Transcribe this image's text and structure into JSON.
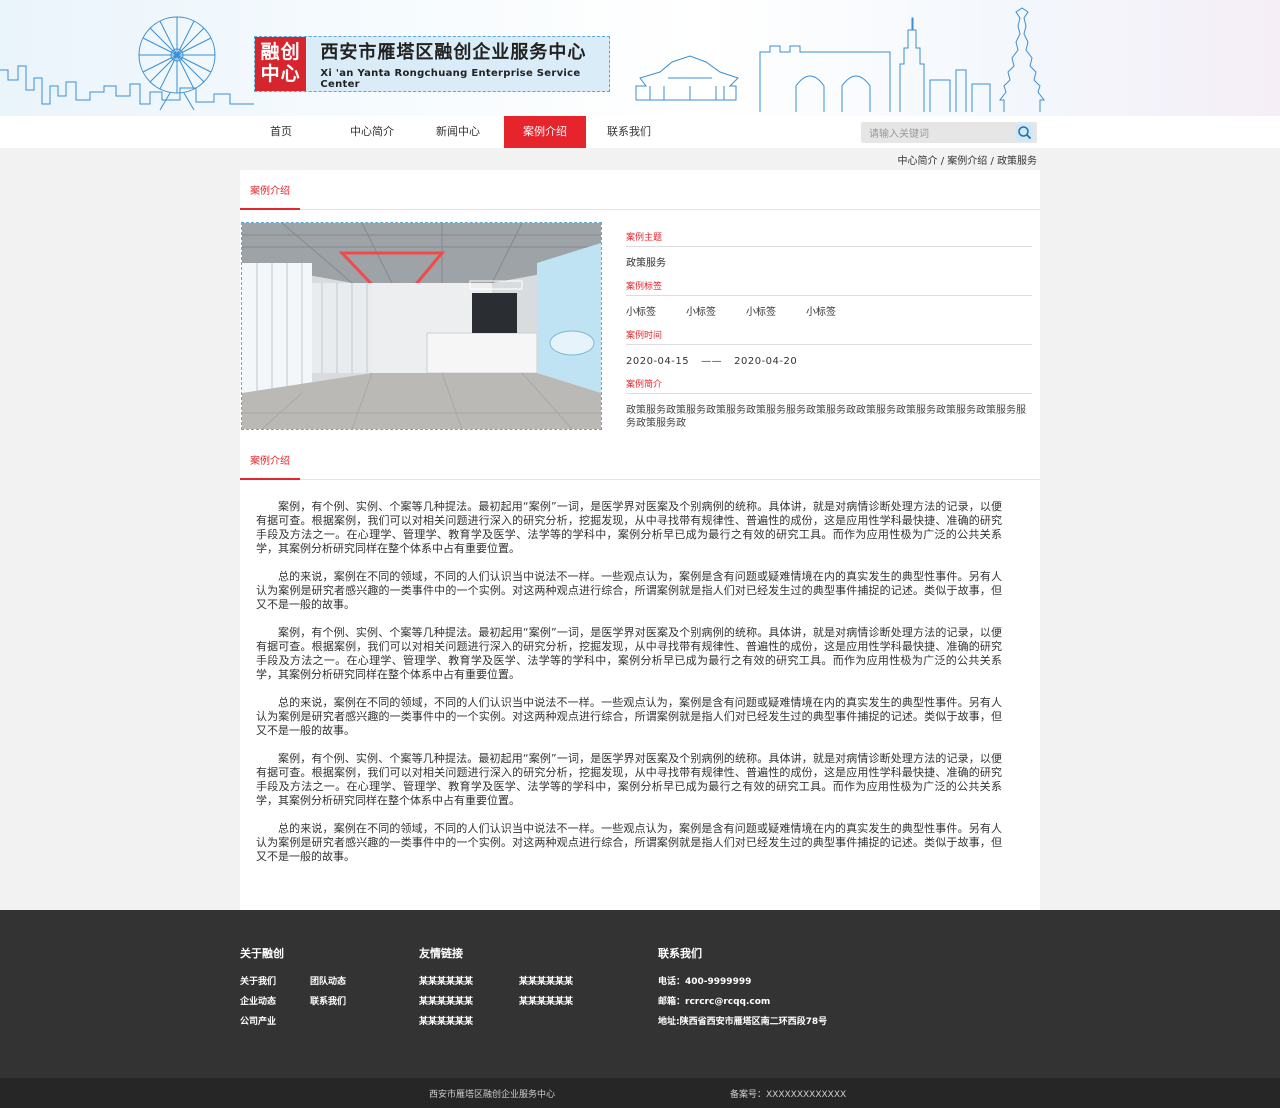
{
  "header": {
    "logo_seal": "融创中心",
    "logo_cn": "西安市雁塔区融创企业服务中心",
    "logo_en": "Xi 'an Yanta Rongchuang Enterprise Service Center"
  },
  "nav": {
    "items": [
      "首页",
      "中心简介",
      "新闻中心",
      "案例介绍",
      "联系我们"
    ],
    "active": "案例介绍"
  },
  "search": {
    "placeholder": "请输入关键词"
  },
  "breadcrumb": "中心简介 / 案例介绍 / 政策服务",
  "case_section": {
    "tab_label": "案例介绍",
    "subject_label": "案例主题",
    "subject_value": "政策服务",
    "tags_label": "案例标签",
    "tags": [
      "小标签",
      "小标签",
      "小标签",
      "小标签"
    ],
    "time_label": "案例时间",
    "start_date": "2020-04-15",
    "date_sep": "——",
    "end_date": "2020-04-20",
    "intro_label": "案例简介",
    "intro_text": "政策服务政策服务政策服务政策服务服务政策服务政政策服务政策服务政策服务政策服务服务政策服务政"
  },
  "article_section": {
    "tab_label": "案例介绍",
    "paragraphs": [
      "案例，有个例、实例、个案等几种提法。最初起用“案例”一词，是医学界对医案及个别病例的统称。具体讲，就是对病情诊断处理方法的记录，以便有据可查。根据案例，我们可以对相关问题进行深入的研究分析，挖掘发现，从中寻找带有规律性、普遍性的成份，这是应用性学科最快捷、准确的研究手段及方法之一。在心理学、管理学、教育学及医学、法学等的学科中，案例分析早已成为最行之有效的研究工具。而作为应用性极为广泛的公共关系学，其案例分析研究同样在整个体系中占有重要位置。",
      "总的来说，案例在不同的领域，不同的人们认识当中说法不一样。一些观点认为，案例是含有问题或疑难情境在内的真实发生的典型性事件。另有人认为案例是研究者感兴趣的一类事件中的一个实例。对这两种观点进行综合，所谓案例就是指人们对已经发生过的典型事件捕捉的记述。类似于故事，但又不是一般的故事。",
      "案例，有个例、实例、个案等几种提法。最初起用“案例”一词，是医学界对医案及个别病例的统称。具体讲，就是对病情诊断处理方法的记录，以便有据可查。根据案例，我们可以对相关问题进行深入的研究分析，挖掘发现，从中寻找带有规律性、普遍性的成份，这是应用性学科最快捷、准确的研究手段及方法之一。在心理学、管理学、教育学及医学、法学等的学科中，案例分析早已成为最行之有效的研究工具。而作为应用性极为广泛的公共关系学，其案例分析研究同样在整个体系中占有重要位置。",
      "总的来说，案例在不同的领域，不同的人们认识当中说法不一样。一些观点认为，案例是含有问题或疑难情境在内的真实发生的典型性事件。另有人认为案例是研究者感兴趣的一类事件中的一个实例。对这两种观点进行综合，所谓案例就是指人们对已经发生过的典型事件捕捉的记述。类似于故事，但又不是一般的故事。",
      "案例，有个例、实例、个案等几种提法。最初起用“案例”一词，是医学界对医案及个别病例的统称。具体讲，就是对病情诊断处理方法的记录，以便有据可查。根据案例，我们可以对相关问题进行深入的研究分析，挖掘发现，从中寻找带有规律性、普遍性的成份，这是应用性学科最快捷、准确的研究手段及方法之一。在心理学、管理学、教育学及医学、法学等的学科中，案例分析早已成为最行之有效的研究工具。而作为应用性极为广泛的公共关系学，其案例分析研究同样在整个体系中占有重要位置。",
      "总的来说，案例在不同的领域，不同的人们认识当中说法不一样。一些观点认为，案例是含有问题或疑难情境在内的真实发生的典型性事件。另有人认为案例是研究者感兴趣的一类事件中的一个实例。对这两种观点进行综合，所谓案例就是指人们对已经发生过的典型事件捕捉的记述。类似于故事，但又不是一般的故事。"
    ]
  },
  "footer": {
    "about_title": "关于融创",
    "about_links": [
      "关于我们",
      "团队动态",
      "企业动态",
      "联系我们",
      "公司产业"
    ],
    "friend_title": "友情链接",
    "friend_links": [
      "某某某某某某",
      "某某某某某某",
      "某某某某某某",
      "某某某某某某",
      "某某某某某某"
    ],
    "contact_title": "联系我们",
    "phone": "电话：400-9999999",
    "email": "邮箱：rcrcrc@rcqq.com",
    "address": "地址:陕西省西安市雁塔区南二环西段78号",
    "copyright": "西安市雁塔区融创企业服务中心",
    "icp": "备案号：XXXXXXXXXXXXX"
  },
  "colors": {
    "accent": "#e5242b",
    "footer_bg": "#333333",
    "line_art": "#3b8fd4"
  }
}
